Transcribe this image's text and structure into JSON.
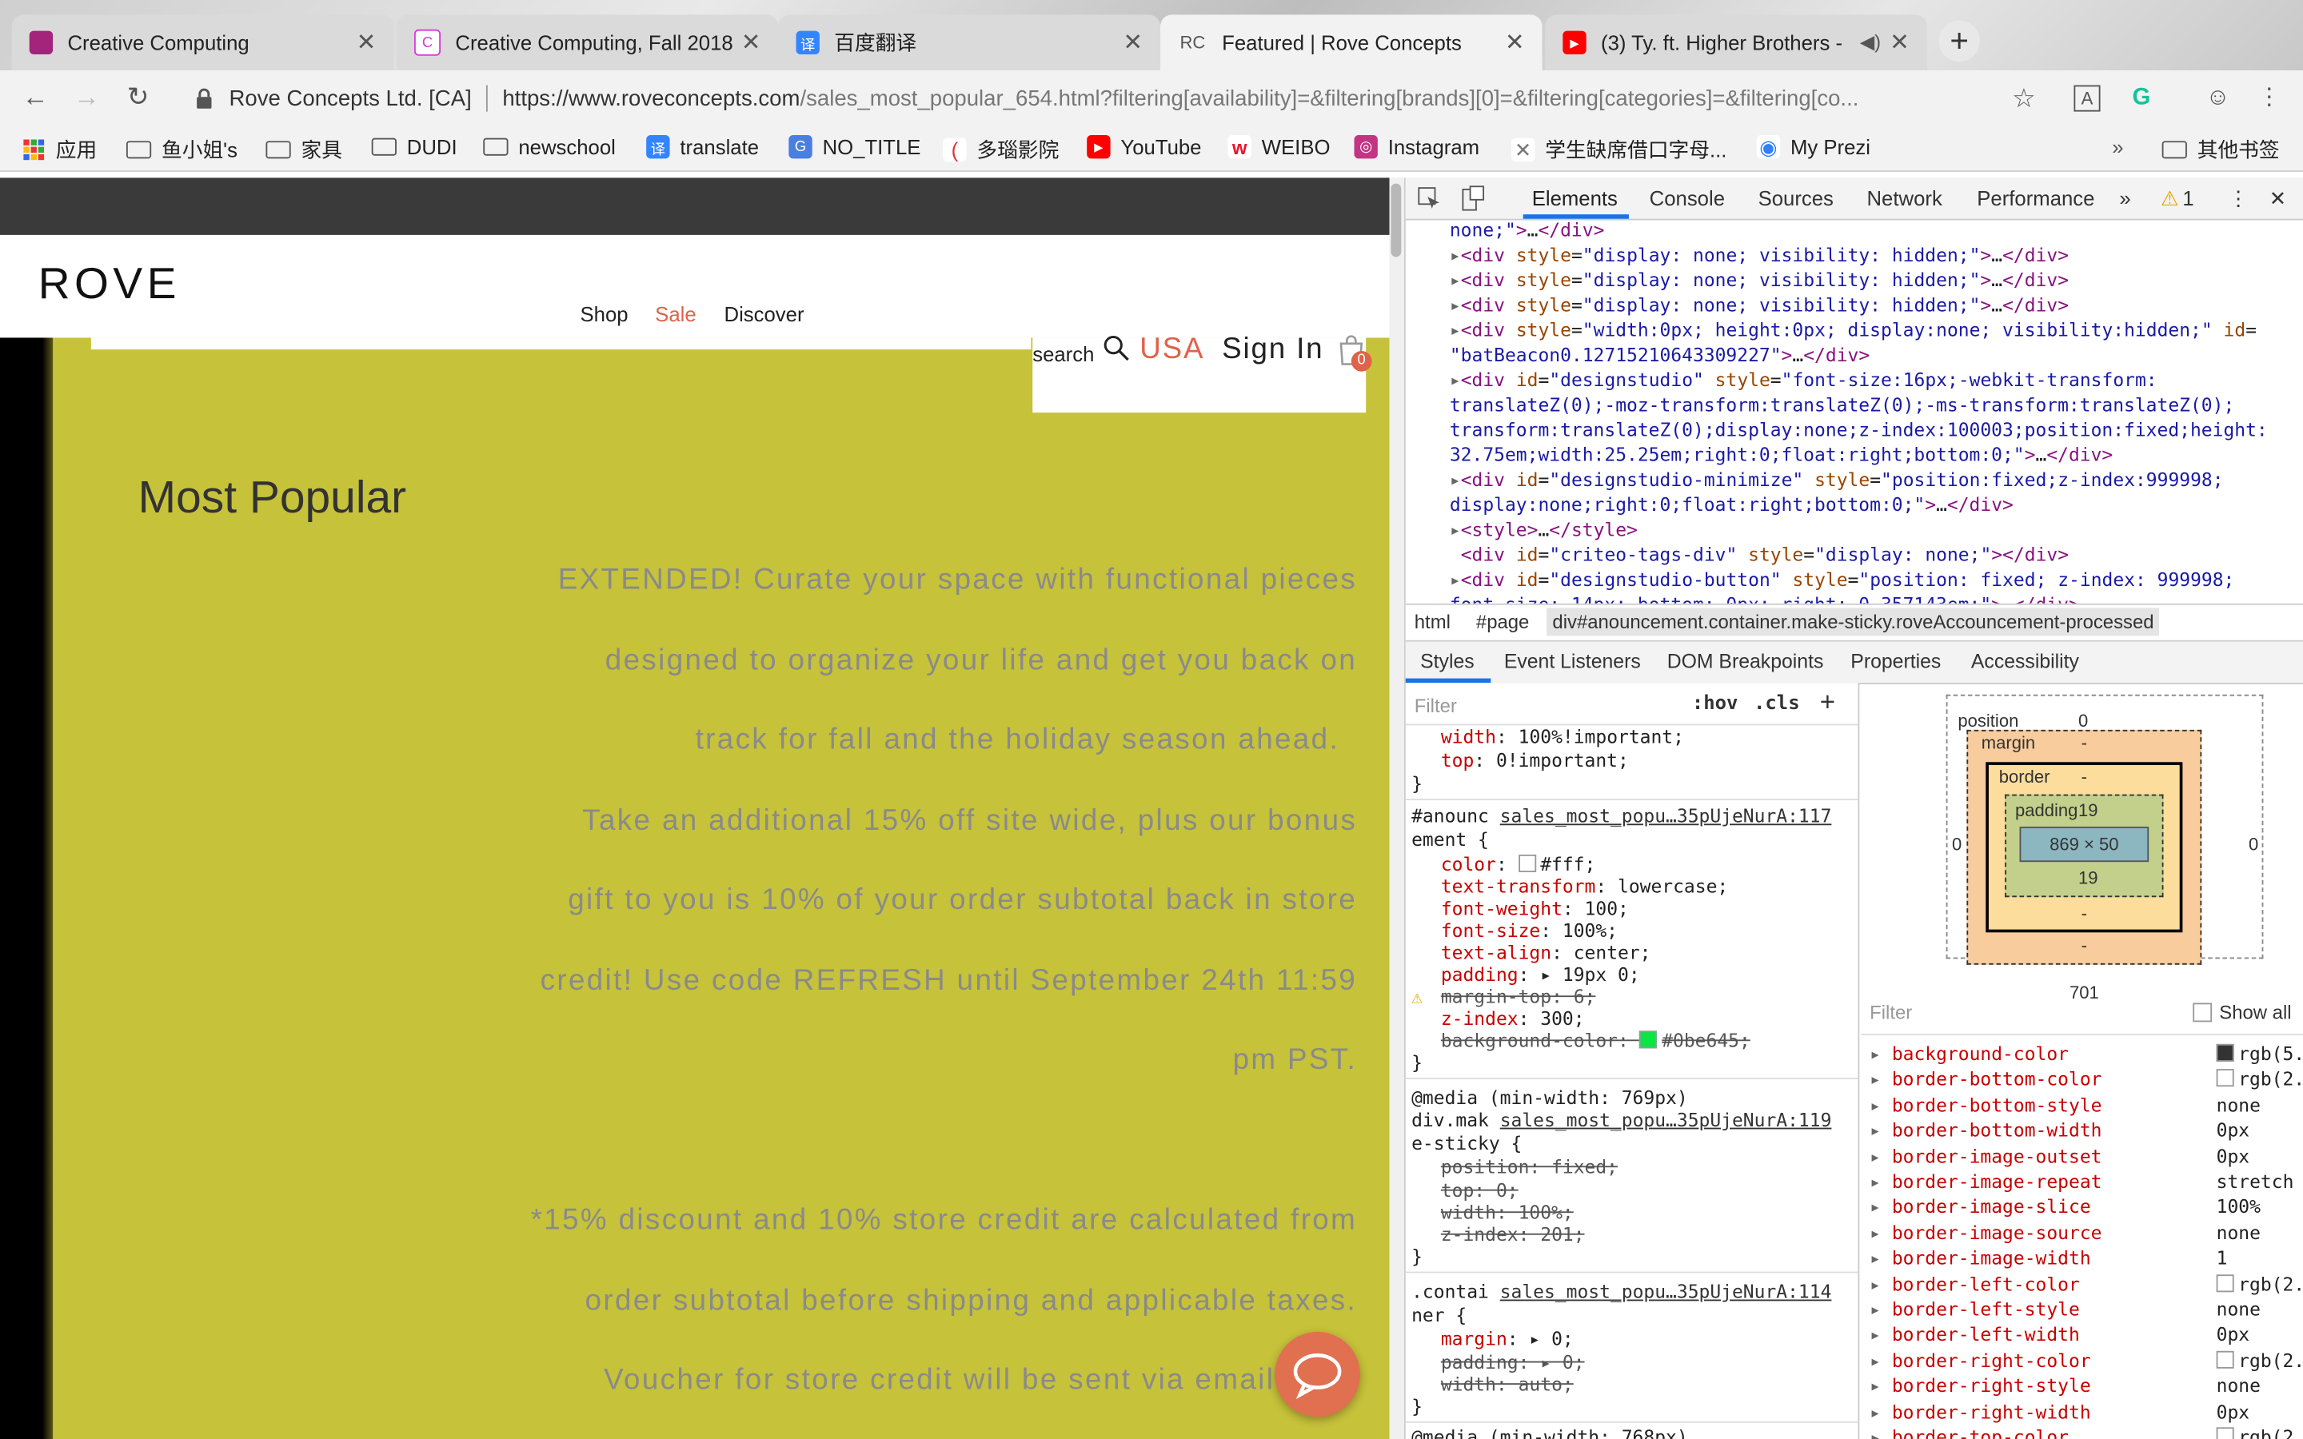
{
  "browser": {
    "tabs": [
      {
        "title": "Creative Computing",
        "favicon_color": "#a3247a",
        "favicon_text": ""
      },
      {
        "title": "Creative Computing, Fall 2018",
        "favicon_color": "#d63ad6",
        "favicon_text": "C"
      },
      {
        "title": "百度翻译",
        "favicon_color": "#3385ff",
        "favicon_text": "译"
      },
      {
        "title": "Featured | Rove Concepts",
        "favicon_color": "#f2f2f2",
        "favicon_text": "RC"
      },
      {
        "title": "(3) Ty. ft. Higher Brothers -",
        "favicon_color": "#ff0000",
        "favicon_text": "▶"
      }
    ],
    "new_tab_label": "+",
    "site_name": "Rove Concepts Ltd. [CA]",
    "url_host": "https://www.roveconcepts.com",
    "url_path": "/sales_most_popular_654.html?filtering[availability]=&filtering[brands][0]=&filtering[categories]=&filtering[co...",
    "bookmarks": [
      {
        "label": "应用",
        "type": "apps"
      },
      {
        "label": "鱼小姐's",
        "type": "folder"
      },
      {
        "label": "家具",
        "type": "folder"
      },
      {
        "label": "DUDI",
        "type": "folder"
      },
      {
        "label": "newschool",
        "type": "folder"
      },
      {
        "label": "translate",
        "type": "site",
        "color": "#3385ff",
        "glyph": "译"
      },
      {
        "label": "NO_TITLE",
        "type": "site",
        "color": "#4a7ee0",
        "glyph": "G"
      },
      {
        "label": "多瑙影院",
        "type": "site",
        "color": "#d33",
        "glyph": "("
      },
      {
        "label": "YouTube",
        "type": "site",
        "color": "#ff0000",
        "glyph": "▶"
      },
      {
        "label": "WEIBO",
        "type": "site",
        "color": "#e6162d",
        "glyph": "w"
      },
      {
        "label": "Instagram",
        "type": "site",
        "color": "#c13584",
        "glyph": "◎"
      },
      {
        "label": "学生缺席借口字母...",
        "type": "site",
        "color": "#777",
        "glyph": "✕"
      },
      {
        "label": "My Prezi",
        "type": "site",
        "color": "#3181ff",
        "glyph": "◉"
      }
    ],
    "bookmarks_overflow": "»",
    "other_bookmarks": "其他书签"
  },
  "page": {
    "logo": "ROVE",
    "nav": {
      "shop": "Shop",
      "sale": "Sale",
      "discover": "Discover"
    },
    "search_label": "search",
    "region": "USA",
    "sign_in": "Sign In",
    "cart_count": "0",
    "heading": "Most Popular",
    "promo_lines": [
      "EXTENDED! Curate your space with functional pieces",
      "designed to organize your life and get you back on",
      "track for fall and the holiday season ahead.",
      "Take an additional 15% off site wide, plus our bonus",
      "gift to you is 10% of your order subtotal back in store",
      "credit! Use code REFRESH until September 24th 11:59",
      "pm PST.",
      "*15% discount and 10% store credit are calculated from",
      "order subtotal before shipping and applicable taxes.",
      "Voucher for store credit will be sent via email"
    ],
    "colors": {
      "accent": "#e0624a",
      "banner": "#c6c23a"
    }
  },
  "devtools": {
    "tabs": [
      "Elements",
      "Console",
      "Sources",
      "Network",
      "Performance",
      "»"
    ],
    "warning_count": "1",
    "breadcrumbs": [
      "html",
      "#page",
      "div#anouncement.container.make-sticky.roveAccouncement-processed"
    ],
    "subtabs": [
      "Styles",
      "Event Listeners",
      "DOM Breakpoints",
      "Properties",
      "Accessibility"
    ],
    "filter_placeholder": "Filter",
    "hov": ":hov",
    "cls": ".cls",
    "box_model": {
      "position_label": "position",
      "position_value": "0",
      "margin_label": "margin",
      "border_label": "border",
      "padding_label": "padding",
      "padding_top": "19",
      "padding_bottom": "19",
      "content": "869 × 50",
      "dash": "-",
      "side_value": "0",
      "below": "701"
    },
    "computed_filter": "Filter",
    "show_all": "Show all",
    "computed": [
      {
        "name": "background-color",
        "value": "rgb(5...",
        "swatch": "#333333"
      },
      {
        "name": "border-bottom-color",
        "value": "rgb(2...",
        "swatch": "#ffffff"
      },
      {
        "name": "border-bottom-style",
        "value": "none"
      },
      {
        "name": "border-bottom-width",
        "value": "0px"
      },
      {
        "name": "border-image-outset",
        "value": "0px"
      },
      {
        "name": "border-image-repeat",
        "value": "stretch"
      },
      {
        "name": "border-image-slice",
        "value": "100%"
      },
      {
        "name": "border-image-source",
        "value": "none"
      },
      {
        "name": "border-image-width",
        "value": "1"
      },
      {
        "name": "border-left-color",
        "value": "rgb(2...",
        "swatch": "#ffffff"
      },
      {
        "name": "border-left-style",
        "value": "none"
      },
      {
        "name": "border-left-width",
        "value": "0px"
      },
      {
        "name": "border-right-color",
        "value": "rgb(2...",
        "swatch": "#ffffff"
      },
      {
        "name": "border-right-style",
        "value": "none"
      },
      {
        "name": "border-right-width",
        "value": "0px"
      },
      {
        "name": "border-top-color",
        "value": "rgb(2...",
        "swatch": "#ffffff"
      }
    ]
  }
}
